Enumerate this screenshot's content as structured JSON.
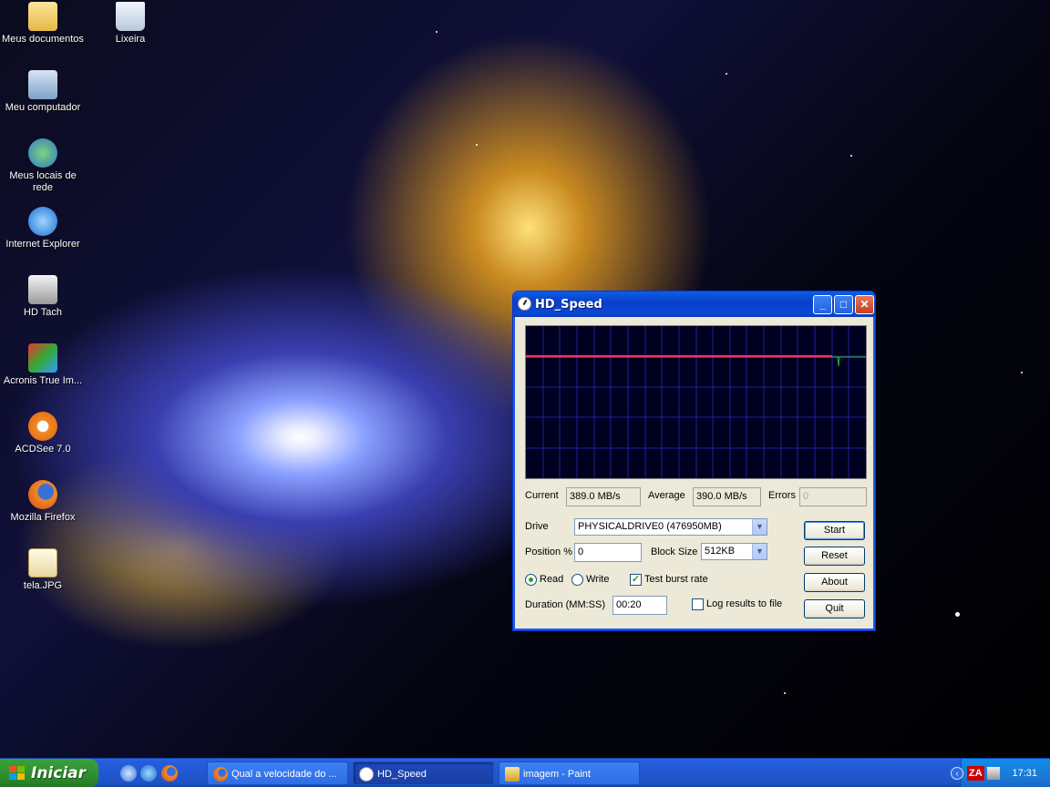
{
  "desktop": {
    "icons": [
      {
        "label": "Meus documentos",
        "icon": "folder-icon"
      },
      {
        "label": "Lixeira",
        "icon": "recycle-bin-icon"
      },
      {
        "label": "Meu computador",
        "icon": "computer-icon"
      },
      {
        "label": "Meus locais de rede",
        "icon": "network-icon"
      },
      {
        "label": "Internet Explorer",
        "icon": "internet-explorer-icon"
      },
      {
        "label": "HD Tach",
        "icon": "hd-tach-icon"
      },
      {
        "label": "Acronis True Im...",
        "icon": "acronis-icon"
      },
      {
        "label": "ACDSee 7.0",
        "icon": "acdsee-icon"
      },
      {
        "label": "Mozilla Firefox",
        "icon": "firefox-icon"
      },
      {
        "label": "tela.JPG",
        "icon": "jpg-file-icon"
      }
    ]
  },
  "window": {
    "title": "HD_Speed",
    "stats": {
      "current_label": "Current",
      "current_value": "389.0 MB/s",
      "average_label": "Average",
      "average_value": "390.0 MB/s",
      "errors_label": "Errors",
      "errors_value": "0"
    },
    "drive_label": "Drive",
    "drive_value": "PHYSICALDRIVE0 (476950MB)",
    "position_label": "Position %",
    "position_value": "0",
    "block_size_label": "Block Size",
    "block_size_value": "512KB",
    "read_label": "Read",
    "write_label": "Write",
    "mode_selected": "Read",
    "burst_label": "Test burst rate",
    "burst_checked": true,
    "duration_label": "Duration (MM:SS)",
    "duration_value": "00:20",
    "log_label": "Log results to file",
    "log_checked": false,
    "buttons": {
      "start": "Start",
      "reset": "Reset",
      "about": "About",
      "quit": "Quit"
    },
    "colors": {
      "graph_background": "#000020",
      "grid": "#2020a0",
      "current_line": "#ff3060",
      "average_line": "#20c020"
    }
  },
  "taskbar": {
    "start_label": "Iniciar",
    "tasks": [
      {
        "label": "Qual a velocidade do ...",
        "icon": "firefox-icon"
      },
      {
        "label": "HD_Speed",
        "icon": "hd-speed-icon",
        "active": true
      },
      {
        "label": "imagem - Paint",
        "icon": "paint-icon"
      }
    ],
    "tray_icon_text": "ZA",
    "clock": "17:31"
  }
}
